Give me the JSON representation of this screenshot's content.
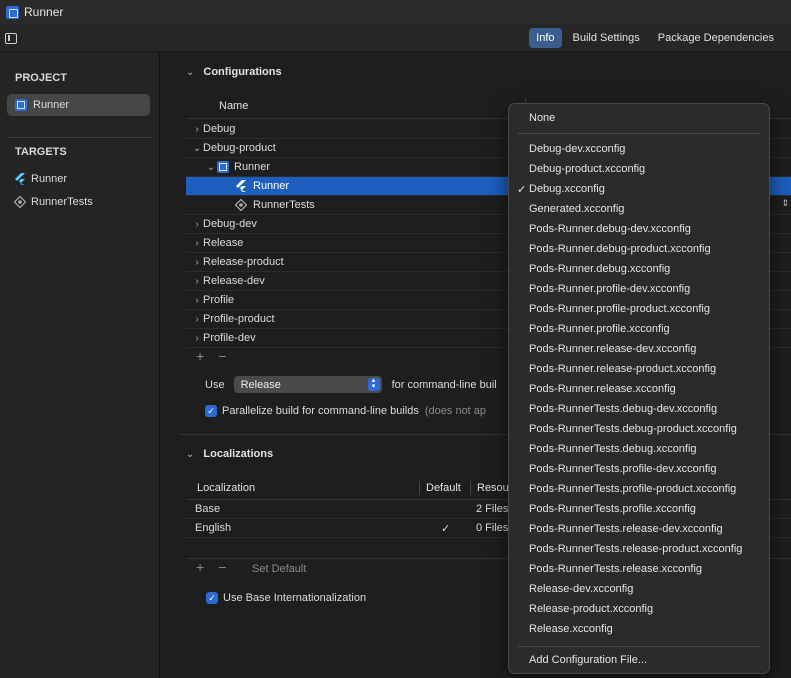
{
  "window": {
    "title": "Runner"
  },
  "toolbar": {
    "tabs": [
      "Info",
      "Build Settings",
      "Package Dependencies"
    ],
    "active_tab": "Info"
  },
  "sidebar": {
    "project_title": "PROJECT",
    "project_item": "Runner",
    "targets_title": "TARGETS",
    "targets": [
      {
        "label": "Runner",
        "icon": "flutter-icon"
      },
      {
        "label": "RunnerTests",
        "icon": "gear-icon"
      }
    ]
  },
  "configurations": {
    "title": "Configurations",
    "name_header": "Name",
    "rows": [
      "Debug",
      "Debug-product",
      "Runner",
      "Runner",
      "RunnerTests",
      "Debug-dev",
      "Release",
      "Release-product",
      "Release-dev",
      "Profile",
      "Profile-product",
      "Profile-dev"
    ],
    "use_label": "Use",
    "use_value": "Release",
    "use_suffix": "for command-line buil",
    "parallelize_label": "Parallelize build for command-line builds",
    "parallelize_note": "(does not ap"
  },
  "localizations": {
    "title": "Localizations",
    "headers": {
      "localization": "Localization",
      "default": "Default",
      "resources": "Resou"
    },
    "rows": [
      {
        "name": "Base",
        "default": "",
        "resources": "2 Files"
      },
      {
        "name": "English",
        "default": "✓",
        "resources": "0 Files"
      }
    ],
    "set_default": "Set Default",
    "use_base_label": "Use Base Internationalization"
  },
  "menu": {
    "none": "None",
    "items": [
      "Debug-dev.xcconfig",
      "Debug-product.xcconfig",
      "Debug.xcconfig",
      "Generated.xcconfig",
      "Pods-Runner.debug-dev.xcconfig",
      "Pods-Runner.debug-product.xcconfig",
      "Pods-Runner.debug.xcconfig",
      "Pods-Runner.profile-dev.xcconfig",
      "Pods-Runner.profile-product.xcconfig",
      "Pods-Runner.profile.xcconfig",
      "Pods-Runner.release-dev.xcconfig",
      "Pods-Runner.release-product.xcconfig",
      "Pods-Runner.release.xcconfig",
      "Pods-RunnerTests.debug-dev.xcconfig",
      "Pods-RunnerTests.debug-product.xcconfig",
      "Pods-RunnerTests.debug.xcconfig",
      "Pods-RunnerTests.profile-dev.xcconfig",
      "Pods-RunnerTests.profile-product.xcconfig",
      "Pods-RunnerTests.profile.xcconfig",
      "Pods-RunnerTests.release-dev.xcconfig",
      "Pods-RunnerTests.release-product.xcconfig",
      "Pods-RunnerTests.release.xcconfig",
      "Release-dev.xcconfig",
      "Release-product.xcconfig",
      "Release.xcconfig"
    ],
    "checked_item": "Debug.xcconfig",
    "add_file": "Add Configuration File..."
  },
  "colors": {
    "selection": "#1d5fbf",
    "accent": "#2f6ad4",
    "active_tab": "#3a5f8c"
  }
}
